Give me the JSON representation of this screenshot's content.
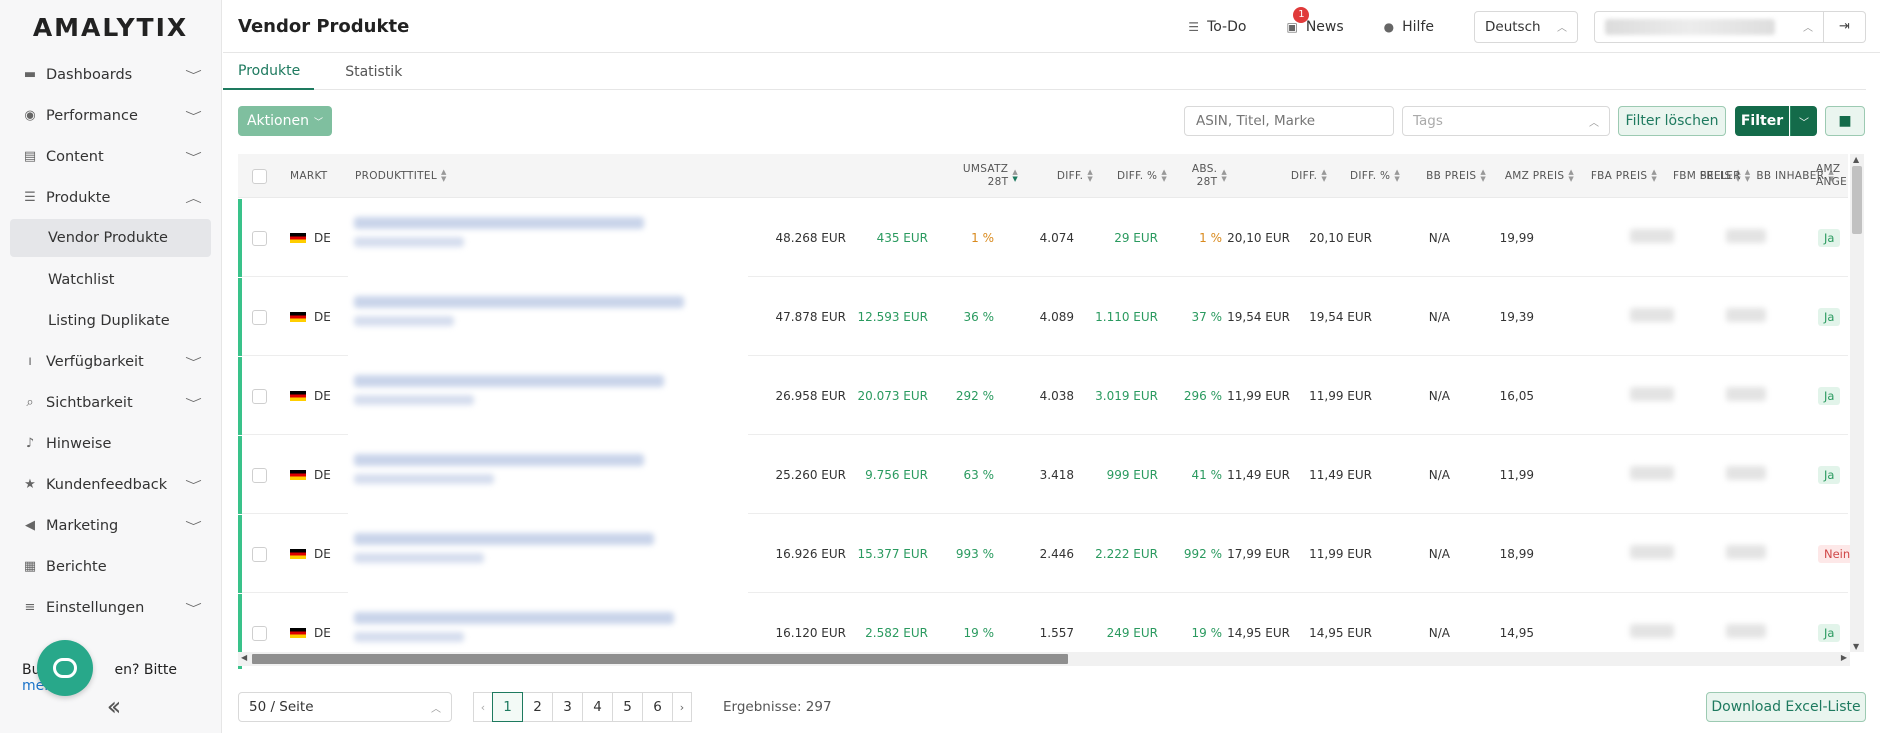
{
  "brand": "AMALYTIX",
  "sidebar": {
    "items": [
      {
        "label": "Dashboards",
        "icon": "dashboard-icon",
        "chev": "v"
      },
      {
        "label": "Performance",
        "icon": "gauge-icon",
        "chev": "v"
      },
      {
        "label": "Content",
        "icon": "content-icon",
        "chev": "v"
      },
      {
        "label": "Produkte",
        "icon": "list-icon",
        "chev": "^"
      }
    ],
    "sub_items": [
      {
        "label": "Vendor Produkte"
      },
      {
        "label": "Watchlist"
      },
      {
        "label": "Listing Duplikate"
      }
    ],
    "items_after": [
      {
        "label": "Verfügbarkeit",
        "icon": "thermometer-icon",
        "chev": "v"
      },
      {
        "label": "Sichtbarkeit",
        "icon": "search-icon",
        "chev": "v"
      },
      {
        "label": "Hinweise",
        "icon": "bell-icon",
        "chev": ""
      },
      {
        "label": "Kundenfeedback",
        "icon": "star-icon",
        "chev": "v"
      },
      {
        "label": "Marketing",
        "icon": "megaphone-icon",
        "chev": "v"
      },
      {
        "label": "Berichte",
        "icon": "table-icon",
        "chev": ""
      },
      {
        "label": "Einstellungen",
        "icon": "sliders-icon",
        "chev": "v"
      }
    ],
    "bug_prefix": "Bu",
    "bug_middle": "en? Bitte ",
    "bug_link": "melden",
    "bug_suffix": "!"
  },
  "header": {
    "title": "Vendor Produkte",
    "todo": "To-Do",
    "news": "News",
    "news_badge": "1",
    "help": "Hilfe",
    "language": "Deutsch"
  },
  "tabs": [
    {
      "label": "Produkte",
      "active": true
    },
    {
      "label": "Statistik",
      "active": false
    }
  ],
  "toolbar": {
    "actions": "Aktionen",
    "search_placeholder": "ASIN, Titel, Marke",
    "tags_placeholder": "Tags",
    "clear_filter": "Filter löschen",
    "filter": "Filter"
  },
  "table": {
    "headers": {
      "markt": "MARKT",
      "titel": "PRODUKTTITEL",
      "umsatz_1": "UMSATZ",
      "umsatz_2": "28T",
      "diff": "DIFF.",
      "diff_pct": "DIFF. %",
      "abs_1": "ABS.",
      "abs_2": "28T",
      "diff2": "DIFF.",
      "diff2_pct": "DIFF. %",
      "bb_preis": "BB PREIS",
      "amz_preis": "AMZ PREIS",
      "fba_preis": "FBA PREIS",
      "fbm_preis": "FBM PREIS",
      "bb_inhaber": "BB INHABER",
      "seller": "SELLER",
      "amz_1": "AMZ",
      "amz_2": "ANGE"
    },
    "rows": [
      {
        "markt": "DE",
        "umsatz": "48.268 EUR",
        "diff": "435 EUR",
        "diff_pct": "1 %",
        "diff_pct_color": "orange",
        "abs": "4.074",
        "diff2": "29 EUR",
        "diff2_pct": "1 %",
        "diff2_pct_color": "orange",
        "bb": "20,10 EUR",
        "amz": "20,10 EUR",
        "fba": "N/A",
        "fbm": "19,99",
        "amz_ang": "Ja"
      },
      {
        "markt": "DE",
        "umsatz": "47.878 EUR",
        "diff": "12.593 EUR",
        "diff_pct": "36 %",
        "diff_pct_color": "green",
        "abs": "4.089",
        "diff2": "1.110 EUR",
        "diff2_pct": "37 %",
        "diff2_pct_color": "green",
        "bb": "19,54 EUR",
        "amz": "19,54 EUR",
        "fba": "N/A",
        "fbm": "19,39",
        "amz_ang": "Ja"
      },
      {
        "markt": "DE",
        "umsatz": "26.958 EUR",
        "diff": "20.073 EUR",
        "diff_pct": "292 %",
        "diff_pct_color": "green",
        "abs": "4.038",
        "diff2": "3.019 EUR",
        "diff2_pct": "296 %",
        "diff2_pct_color": "green",
        "bb": "11,99 EUR",
        "amz": "11,99 EUR",
        "fba": "N/A",
        "fbm": "16,05",
        "amz_ang": "Ja"
      },
      {
        "markt": "DE",
        "umsatz": "25.260 EUR",
        "diff": "9.756 EUR",
        "diff_pct": "63 %",
        "diff_pct_color": "green",
        "abs": "3.418",
        "diff2": "999 EUR",
        "diff2_pct": "41 %",
        "diff2_pct_color": "green",
        "bb": "11,49 EUR",
        "amz": "11,49 EUR",
        "fba": "N/A",
        "fbm": "11,99",
        "amz_ang": "Ja"
      },
      {
        "markt": "DE",
        "umsatz": "16.926 EUR",
        "diff": "15.377 EUR",
        "diff_pct": "993 %",
        "diff_pct_color": "green",
        "abs": "2.446",
        "diff2": "2.222 EUR",
        "diff2_pct": "992 %",
        "diff2_pct_color": "green",
        "bb": "17,99 EUR",
        "amz": "11,99 EUR",
        "fba": "N/A",
        "fbm": "18,99",
        "amz_ang": "Nein"
      },
      {
        "markt": "DE",
        "umsatz": "16.120 EUR",
        "diff": "2.582 EUR",
        "diff_pct": "19 %",
        "diff_pct_color": "green",
        "abs": "1.557",
        "diff2": "249 EUR",
        "diff2_pct": "19 %",
        "diff2_pct_color": "green",
        "bb": "14,95 EUR",
        "amz": "14,95 EUR",
        "fba": "N/A",
        "fbm": "14,95",
        "amz_ang": "Ja"
      }
    ]
  },
  "footer": {
    "page_size": "50 / Seite",
    "pages": [
      "1",
      "2",
      "3",
      "4",
      "5",
      "6"
    ],
    "current_page": "1",
    "results": "Ergebnisse: 297",
    "download": "Download Excel-Liste"
  },
  "colors": {
    "accent": "#1e7a5f",
    "primary_button": "#146b4a",
    "positive": "#2a9a5f",
    "warning": "#d98a1e",
    "negative": "#d04848"
  }
}
